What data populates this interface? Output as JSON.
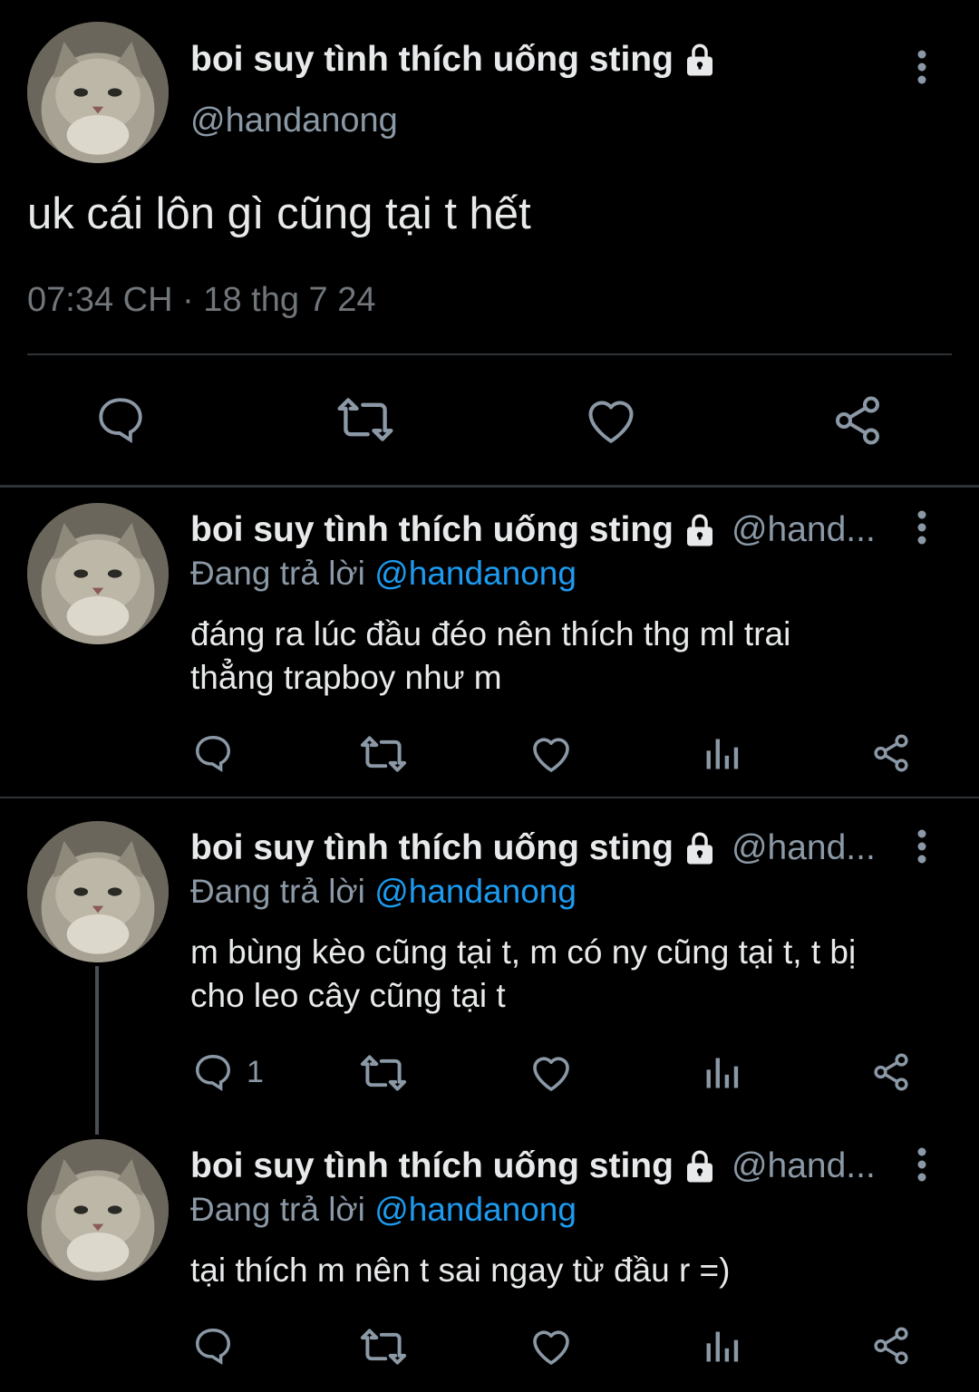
{
  "main_tweet": {
    "display_name": "boi suy tình thích uống sting",
    "handle": "@handanong",
    "text": "uk cái lôn gì cũng tại t hết",
    "timestamp": "07:34 CH · 18 thg 7 24"
  },
  "replies": [
    {
      "display_name": "boi suy tình thích uống sting",
      "handle_truncated": "@hand...",
      "replying_prefix": "Đang trả lời",
      "replying_to": "@handanong",
      "text_lines": [
        "đáng ra lúc đầu đéo nên thích thg ml trai",
        "thẳng trapboy như m"
      ],
      "reply_count": ""
    },
    {
      "display_name": "boi suy tình thích uống sting",
      "handle_truncated": "@hand...",
      "replying_prefix": "Đang trả lời",
      "replying_to": "@handanong",
      "text_lines": [
        "m bùng kèo cũng tại t, m có ny cũng tại t, t bị",
        "cho leo cây cũng tại t"
      ],
      "reply_count": "1"
    },
    {
      "display_name": "boi suy tình thích uống sting",
      "handle_truncated": "@hand...",
      "replying_prefix": "Đang trả lời",
      "replying_to": "@handanong",
      "text_lines": [
        "tại thích m nên t sai ngay từ đầu r =)"
      ],
      "reply_count": ""
    }
  ],
  "icons": {
    "reply": "reply-icon",
    "retweet": "retweet-icon",
    "like": "heart-icon",
    "views": "views-icon",
    "share": "share-icon",
    "more": "more-vertical-icon",
    "lock": "lock-icon"
  },
  "colors": {
    "background": "#000000",
    "text": "#e7e9ea",
    "secondary": "#8b98a5",
    "mention": "#1d9bf0",
    "divider": "#2f3336"
  }
}
